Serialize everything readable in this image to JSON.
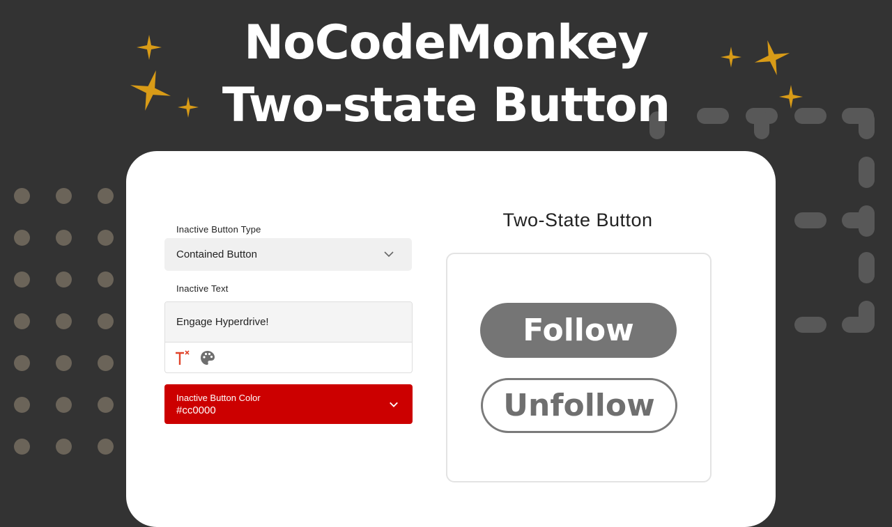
{
  "header": {
    "title_line1": "NoCodeMonkey",
    "title_line2": "Two-state Button"
  },
  "form": {
    "button_type": {
      "label": "Inactive Button Type",
      "value": "Contained Button"
    },
    "text": {
      "label": "Inactive Text",
      "value": "Engage Hyperdrive!"
    },
    "toolbar": {
      "icons": [
        "text-format-icon",
        "palette-icon"
      ]
    },
    "color": {
      "label": "Inactive Button Color",
      "value": "#cc0000"
    }
  },
  "preview": {
    "title": "Two-State Button",
    "follow_label": "Follow",
    "unfollow_label": "Unfollow"
  },
  "colors": {
    "background": "#333333",
    "sparkle": "#d89b17",
    "accent_red": "#cc0000",
    "follow_fill": "#757575"
  }
}
